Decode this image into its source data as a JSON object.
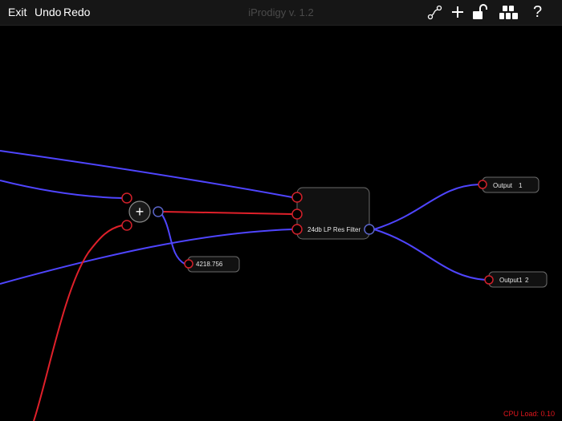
{
  "toolbar": {
    "exit_label": "Exit",
    "undo_label": "Undo",
    "redo_label": "Redo",
    "title": "iProdigy v. 1.2",
    "icons": [
      "connect-cable-icon",
      "add-module-icon",
      "unlock-icon",
      "module-library-icon",
      "help-icon"
    ],
    "help_label": "?"
  },
  "nodes": {
    "filter": {
      "label": "24db LP Res Filter"
    },
    "constant": {
      "label": "4218.756"
    },
    "output_1": {
      "label": "Output",
      "channel": "1"
    },
    "output_2": {
      "label": "Output1",
      "channel": "2"
    },
    "adder": {
      "symbol": "+"
    }
  },
  "status": {
    "cpu_load": "CPU Load: 0.10"
  },
  "colors": {
    "background": "#000000",
    "toolbar": "#161616",
    "audio_cable": "#4f45ff",
    "control_cable": "#e0202a",
    "input_port": "#d0202a",
    "output_port": "#5a64c8",
    "node_border": "#7a7a7a",
    "cpu_text": "#e0161d"
  }
}
